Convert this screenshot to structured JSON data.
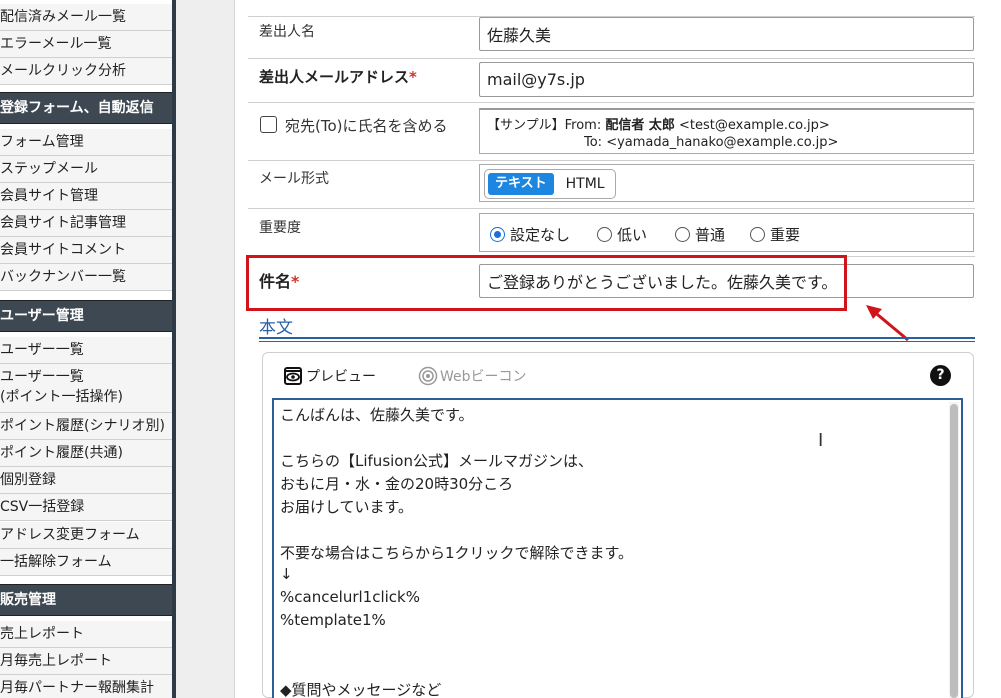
{
  "sidebar": {
    "items_group1": [
      "配信済みメール一覧",
      "エラーメール一覧",
      "メールクリック分析"
    ],
    "header_forms": "登録フォーム、自動返信",
    "items_group2": [
      "フォーム管理",
      "ステップメール",
      "会員サイト管理",
      "会員サイト記事管理",
      "会員サイトコメント",
      "バックナンバー一覧"
    ],
    "header_users": "ユーザー管理",
    "items_group3": [
      "ユーザー一覧",
      "ユーザー一覧\n(ポイント一括操作)",
      "ポイント履歴(シナリオ別)",
      "ポイント履歴(共通)",
      "個別登録",
      "CSV一括登録",
      "アドレス変更フォーム",
      "一括解除フォーム"
    ],
    "header_sales": "販売管理",
    "items_group4": [
      "売上レポート",
      "月毎売上レポート",
      "月毎パートナー報酬集計"
    ]
  },
  "form": {
    "sender_name_label": "差出人名",
    "sender_name_value": "佐藤久美",
    "sender_email_label": "差出人メールアドレス",
    "sender_email_value": "mail@y7s.jp",
    "required_mark": "*",
    "include_name_label": "宛先(To)に氏名を含める",
    "preview_from_prefix": "【サンプル】From: ",
    "preview_from_name": "配信者 太郎",
    "preview_from_addr": " <test@example.co.jp>",
    "preview_to": "To: <yamada_hanako@example.co.jp>",
    "mail_format_label": "メール形式",
    "format_text": "テキスト",
    "format_html": "HTML",
    "priority_label": "重要度",
    "priority_options": [
      "設定なし",
      "低い",
      "普通",
      "重要"
    ],
    "subject_label": "件名",
    "subject_value": "ご登録ありがとうございました。佐藤久美です。",
    "body_title": "本文"
  },
  "editor": {
    "preview_tab": "プレビュー",
    "beacon_tab": "Webビーコン",
    "help": "?",
    "lines": [
      "こんばんは、佐藤久美です。",
      "",
      "こちらの【Lifusion公式】メールマガジンは、",
      "おもに月・水・金の20時30分ころ",
      "お届けしています。",
      "",
      "不要な場合はこちらから1クリックで解除できます。",
      "↓",
      "%cancelurl1click%",
      "%template1%",
      "",
      "",
      "◆質問やメッセージなど"
    ]
  },
  "colors": {
    "accent_blue": "#1c86e0",
    "highlight_red": "#d0141a",
    "sidebar_header": "#3d4852"
  }
}
